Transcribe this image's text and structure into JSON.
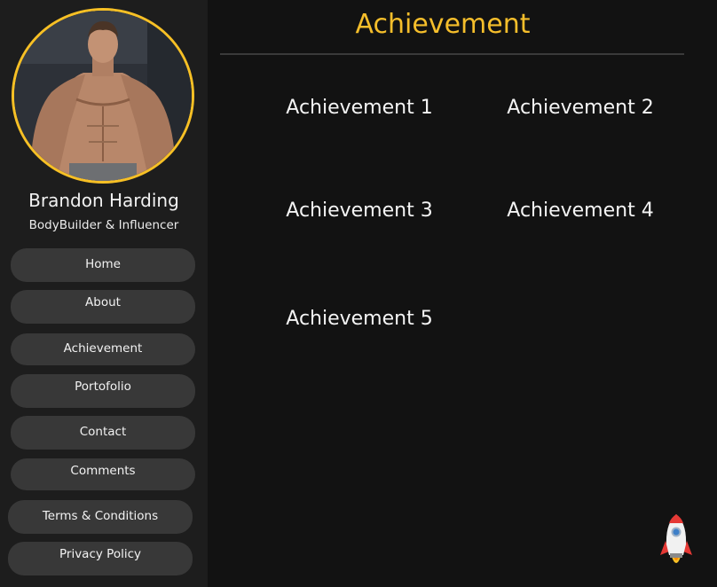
{
  "profile": {
    "name": "Brandon Harding",
    "role": "BodyBuilder & Influencer"
  },
  "nav": {
    "items": [
      {
        "label": "Home"
      },
      {
        "label": "About"
      },
      {
        "label": "Achievement"
      },
      {
        "label": "Portofolio"
      },
      {
        "label": "Contact"
      },
      {
        "label": "Comments"
      },
      {
        "label": "Terms & Conditions"
      },
      {
        "label": "Privacy Policy"
      }
    ]
  },
  "main": {
    "title": "Achievement",
    "achievements": [
      {
        "label": "Achievement 1"
      },
      {
        "label": "Achievement 2"
      },
      {
        "label": "Achievement 3"
      },
      {
        "label": "Achievement 4"
      },
      {
        "label": "Achievement 5"
      }
    ]
  },
  "colors": {
    "accent": "#f5be2b",
    "sidebar_bg": "#1d1d1d",
    "page_bg": "#121212",
    "button_bg": "#383838"
  },
  "icons": {
    "scroll_to_top": "rocket-icon"
  }
}
